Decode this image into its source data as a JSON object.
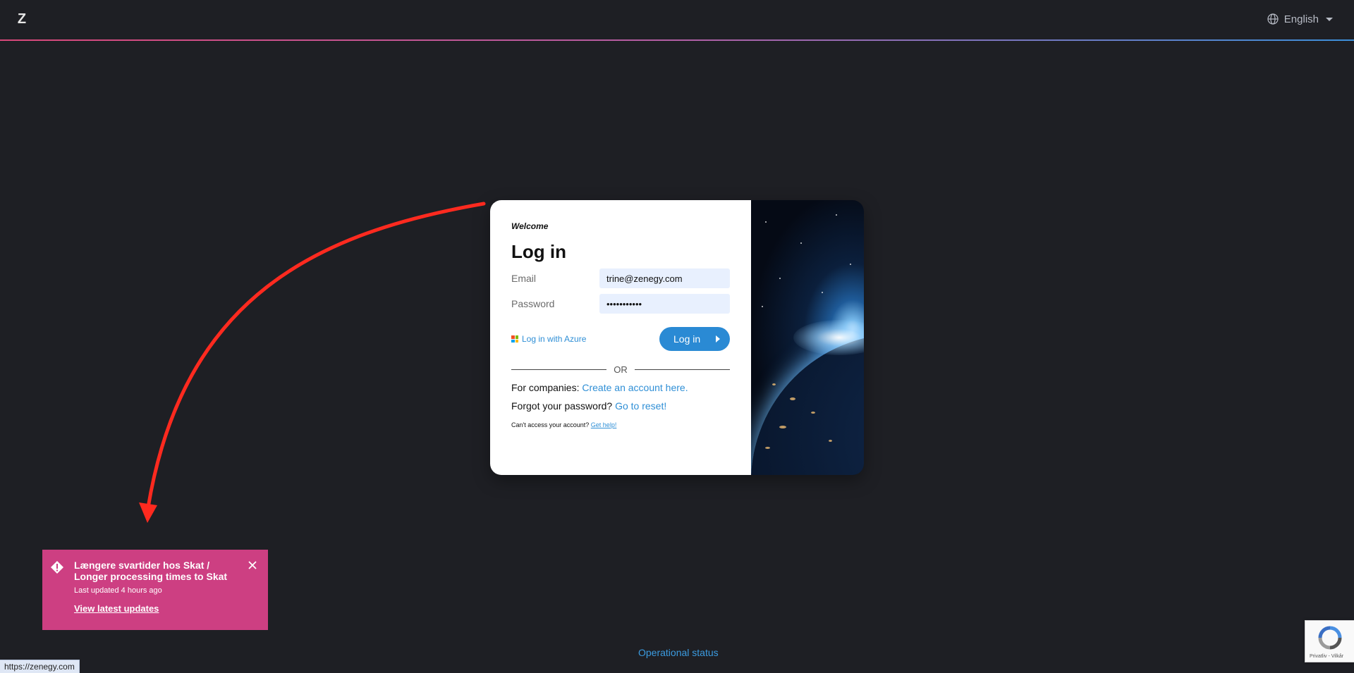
{
  "header": {
    "logo_text": "Z",
    "language": "English"
  },
  "login": {
    "welcome": "Welcome",
    "title": "Log in",
    "email_label": "Email",
    "email_value": "trine@zenegy.com",
    "password_label": "Password",
    "password_value": "•••••••••••",
    "azure_link": "Log in with Azure",
    "login_button": "Log in",
    "or_text": "OR",
    "companies_text": "For companies:",
    "companies_link": "Create an account here.",
    "forgot_text": "Forgot your password?",
    "forgot_link": "Go to reset!",
    "cant_access_text": "Can't access your account?",
    "cant_access_link": "Get help!"
  },
  "notification": {
    "title": "Længere svartider hos Skat / Longer processing times to Skat",
    "subtitle": "Last updated 4 hours ago",
    "link": "View latest updates"
  },
  "footer": {
    "status_link": "Operational status",
    "url_hint": "https://zenegy.com",
    "recaptcha_text": "Privatliv - Vilkår"
  },
  "colors": {
    "background": "#1e1f24",
    "accent_blue": "#2a8ad4",
    "notification_pink": "#cd3f82",
    "annotation_arrow": "#ff2a1f"
  },
  "icons": {
    "logo": "zenegy-logo-icon",
    "language": "globe-icon",
    "notification": "warning-diamond-icon",
    "close": "close-icon",
    "login_button": "play-icon",
    "azure": "microsoft-logo-icon",
    "recaptcha": "recaptcha-icon"
  }
}
